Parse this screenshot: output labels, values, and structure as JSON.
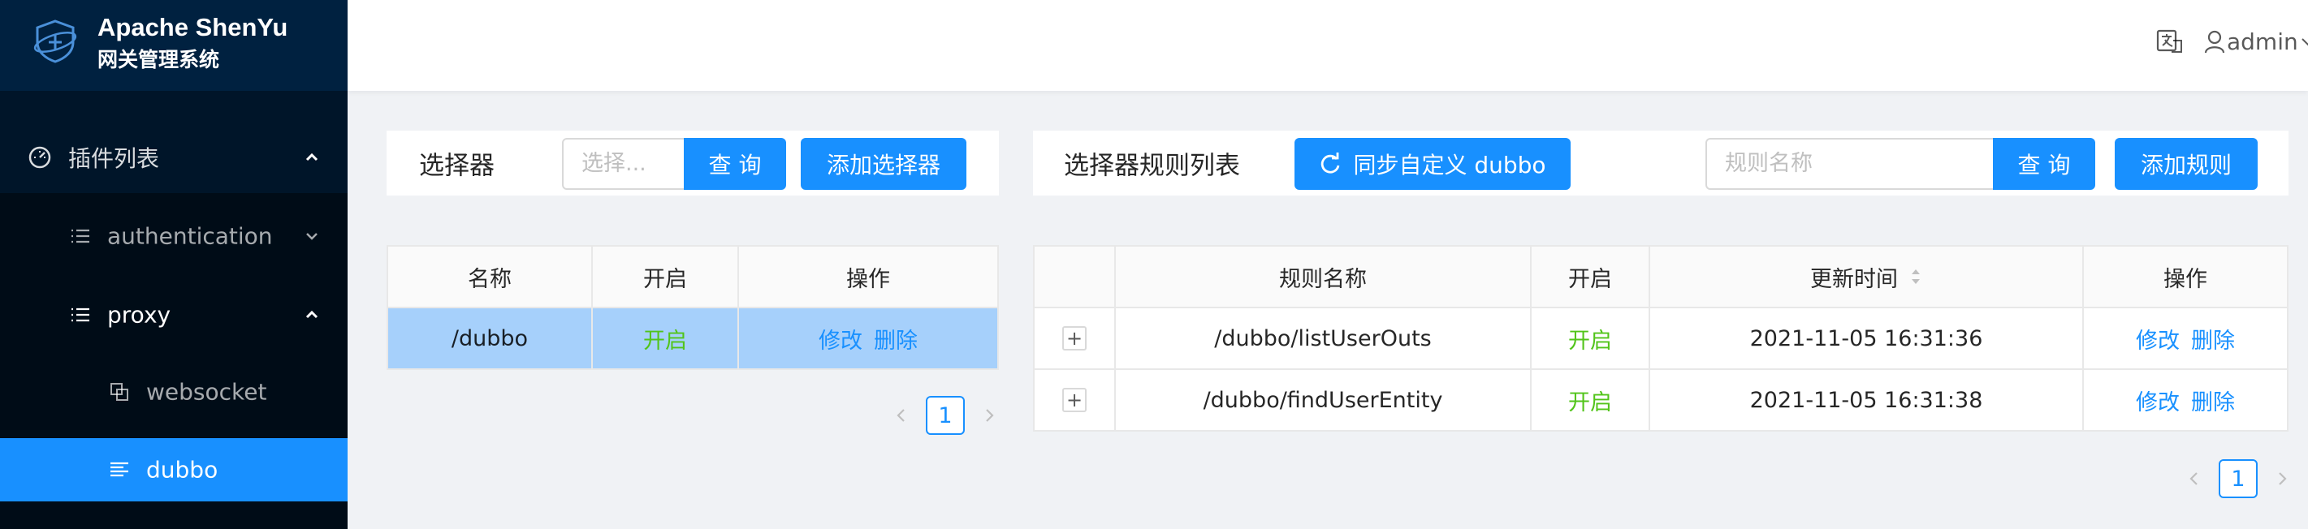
{
  "app": {
    "title": "Apache ShenYu",
    "subtitle": "网关管理系统"
  },
  "sidebar": {
    "menu": [
      {
        "label": "插件列表",
        "icon": "dashboard-icon",
        "expanded": true
      },
      {
        "label": "authentication",
        "icon": "list-icon",
        "expanded": false
      },
      {
        "label": "proxy",
        "icon": "list-icon",
        "expanded": true
      },
      {
        "label": "websocket",
        "icon": "block-icon"
      },
      {
        "label": "dubbo",
        "icon": "align-left-icon",
        "active": true
      }
    ]
  },
  "header": {
    "user": "admin",
    "icons": [
      "translate-icon",
      "user-icon",
      "chevron-down-icon"
    ]
  },
  "selector_panel": {
    "title": "选择器",
    "search_placeholder": "选择...",
    "query_label": "查 询",
    "add_label": "添加选择器",
    "columns": [
      "名称",
      "开启",
      "操作"
    ],
    "rows": [
      {
        "name": "/dubbo",
        "enabled": "开启",
        "edit": "修改",
        "delete": "删除",
        "selected": true
      }
    ],
    "page": "1"
  },
  "rule_panel": {
    "title": "选择器规则列表",
    "sync_label": "同步自定义 dubbo",
    "search_placeholder": "规则名称",
    "query_label": "查 询",
    "add_label": "添加规则",
    "columns": [
      "",
      "规则名称",
      "开启",
      "更新时间",
      "操作"
    ],
    "rows": [
      {
        "expand": "+",
        "name": "/dubbo/listUserOuts",
        "enabled": "开启",
        "updated": "2021-11-05 16:31:36",
        "edit": "修改",
        "delete": "删除"
      },
      {
        "expand": "+",
        "name": "/dubbo/findUserEntity",
        "enabled": "开启",
        "updated": "2021-11-05 16:31:38",
        "edit": "修改",
        "delete": "删除"
      }
    ],
    "page": "1"
  },
  "colors": {
    "primary": "#1890ff",
    "sidebar_bg": "#001529",
    "success": "#52c41a",
    "selected_row": "#a6d0fb"
  }
}
